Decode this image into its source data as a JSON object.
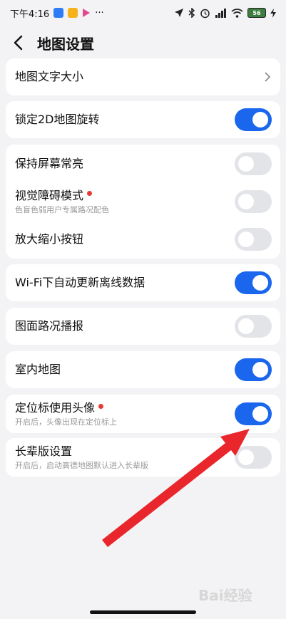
{
  "status": {
    "time": "下午4:16",
    "more": "···",
    "battery": "56"
  },
  "header": {
    "title": "地图设置"
  },
  "settings": {
    "font_size": {
      "label": "地图文字大小"
    },
    "lock_2d": {
      "label": "锁定2D地图旋转",
      "on": true
    },
    "screen_on": {
      "label": "保持屏幕常亮",
      "on": false
    },
    "visual": {
      "label": "视觉障碍模式",
      "sub": "色盲色弱用户专属路况配色",
      "on": false
    },
    "zoom_btn": {
      "label": "放大缩小按钮",
      "on": false
    },
    "wifi": {
      "label": "Wi-Fi下自动更新离线数据",
      "on": true
    },
    "traffic": {
      "label": "图面路况播报",
      "on": false
    },
    "indoor": {
      "label": "室内地图",
      "on": true
    },
    "avatar": {
      "label": "定位标使用头像",
      "sub": "开启后，头像出现在定位标上",
      "on": true
    },
    "elder": {
      "label": "长辈版设置",
      "sub": "开启后，启动高德地图默认进入长辈版",
      "on": false
    }
  },
  "colors": {
    "toggle_on": "#1a67ee",
    "toggle_off": "#e3e4e8",
    "badge_dot": "#e63b35",
    "annotation_arrow": "#e8262b"
  },
  "watermark": "Bai经验"
}
